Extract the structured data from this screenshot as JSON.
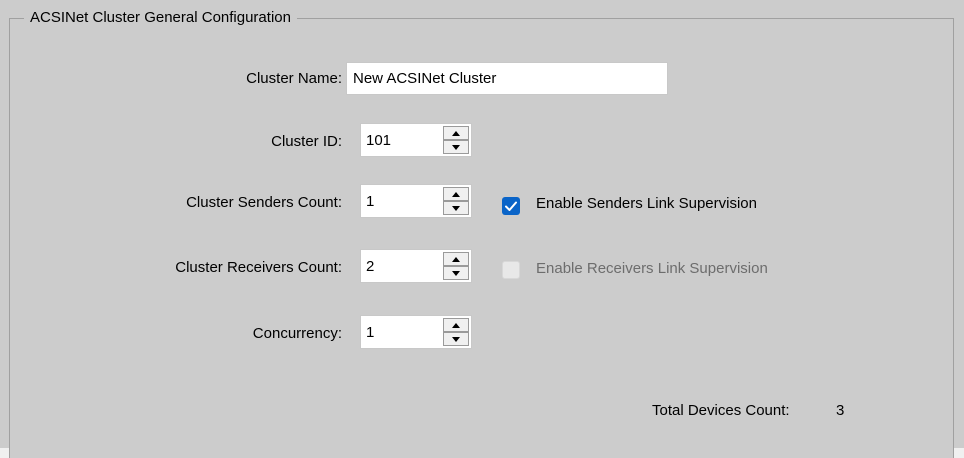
{
  "group": {
    "title": "ACSINet Cluster General Configuration"
  },
  "fields": {
    "cluster_name": {
      "label": "Cluster Name:",
      "value": "New ACSINet Cluster"
    },
    "cluster_id": {
      "label": "Cluster ID:",
      "value": "101"
    },
    "senders_count": {
      "label": "Cluster Senders Count:",
      "value": "1"
    },
    "receivers_count": {
      "label": "Cluster Receivers Count:",
      "value": "2"
    },
    "concurrency": {
      "label": "Concurrency:",
      "value": "1"
    }
  },
  "options": {
    "senders_supervision": {
      "label": "Enable Senders Link Supervision",
      "checked": true,
      "enabled": true
    },
    "receivers_supervision": {
      "label": "Enable Receivers Link Supervision",
      "checked": false,
      "enabled": false
    }
  },
  "summary": {
    "label": "Total Devices Count:",
    "value": "3"
  },
  "colors": {
    "panel": "#cccccc",
    "accent": "#0a64c8",
    "disabled_text": "#6d6d6d"
  },
  "icons": {
    "spin_up": "triangle-up-icon",
    "spin_down": "triangle-down-icon",
    "check": "checkmark-icon"
  }
}
